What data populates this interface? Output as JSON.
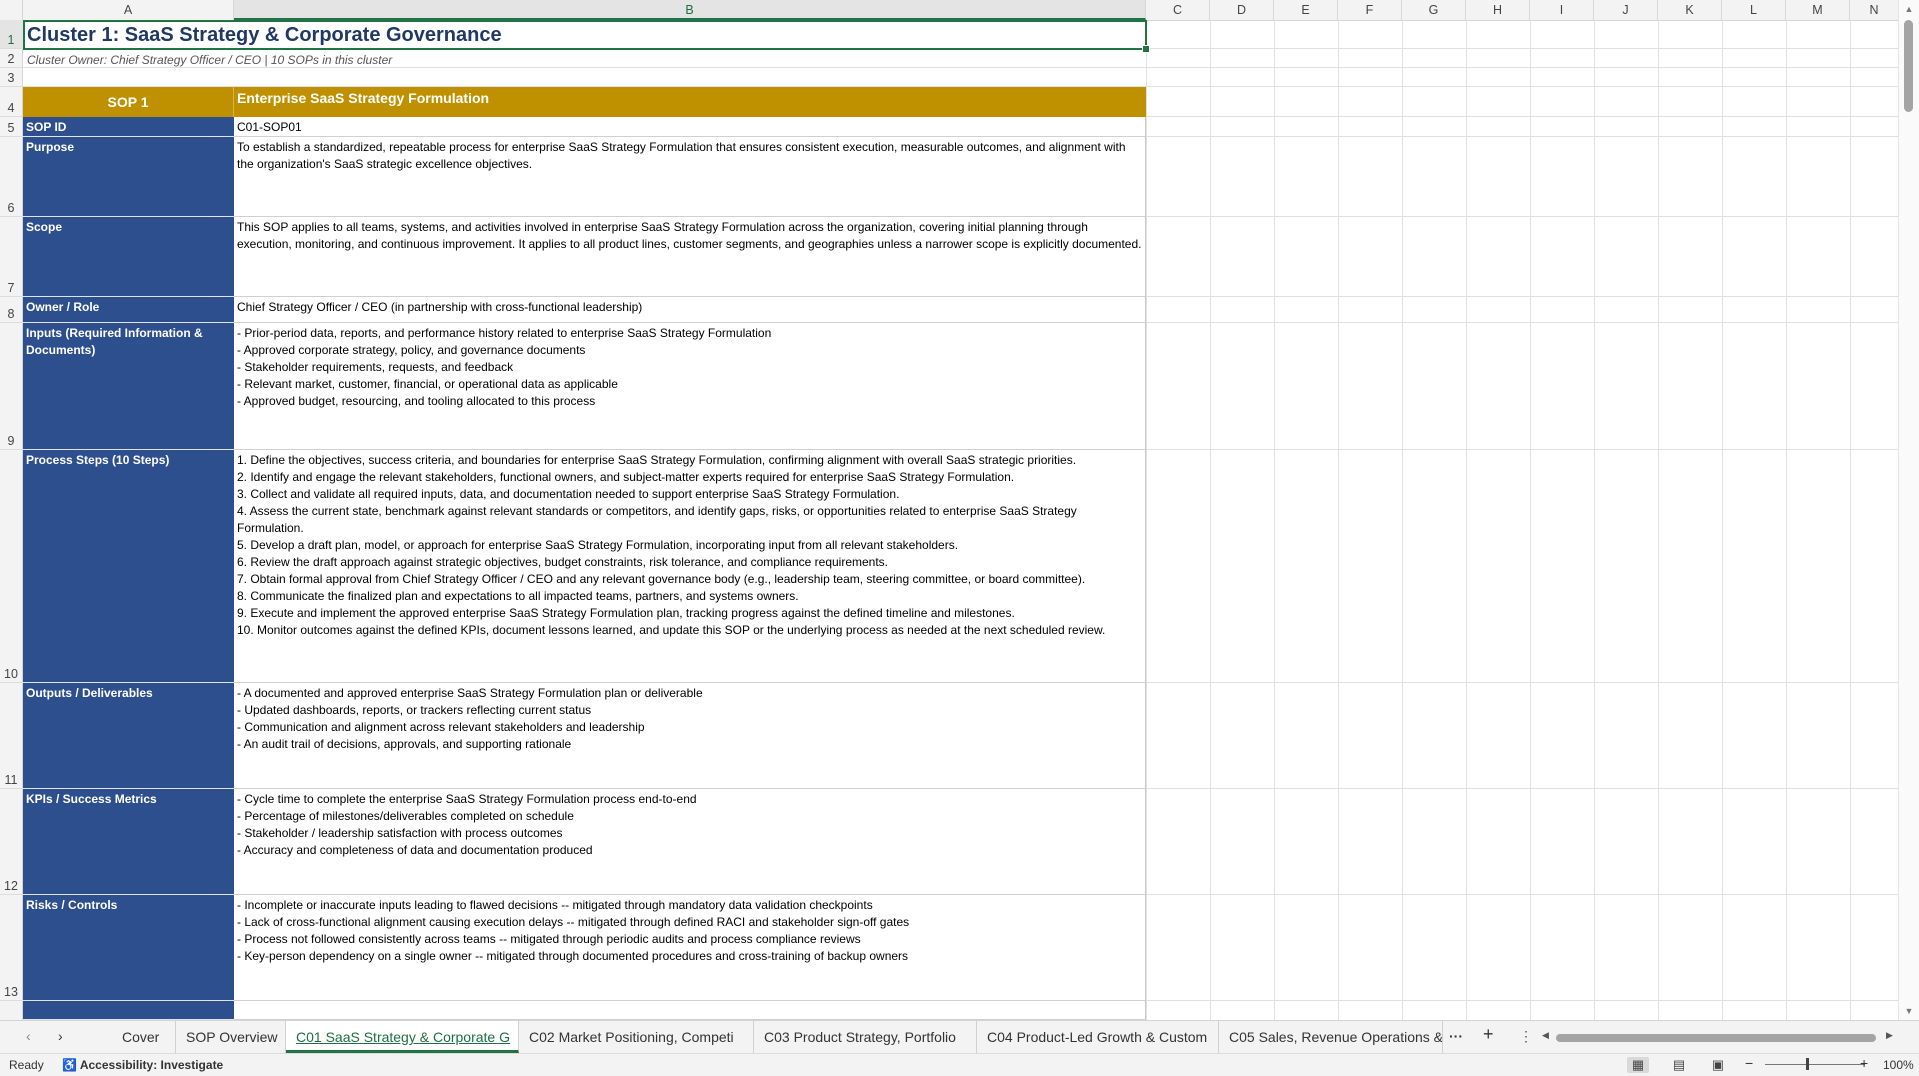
{
  "columns": [
    "A",
    "B",
    "C",
    "D",
    "E",
    "F",
    "G",
    "H",
    "I",
    "J",
    "K",
    "L",
    "M",
    "N"
  ],
  "selected_column": "B",
  "rows": [
    "1",
    "2",
    "3",
    "4",
    "5",
    "6",
    "7",
    "8",
    "9",
    "10",
    "11",
    "12",
    "13"
  ],
  "selected_row": "1",
  "sheet": {
    "title": "Cluster 1: SaaS Strategy & Corporate Governance",
    "subtitle": "Cluster Owner: Chief Strategy Officer / CEO  |  10 SOPs in this cluster",
    "sop_label": "SOP 1",
    "sop_name": "Enterprise SaaS Strategy Formulation",
    "header_color": "#bf9000",
    "label_color": "#2e4f8e",
    "rows": [
      {
        "label": "SOP ID",
        "value": "C01-SOP01"
      },
      {
        "label": "Purpose",
        "value": "To establish a standardized, repeatable process for enterprise SaaS Strategy Formulation that ensures consistent execution, measurable outcomes, and alignment with the organization's SaaS strategic excellence objectives."
      },
      {
        "label": "Scope",
        "value": "This SOP applies to all teams, systems, and activities involved in enterprise SaaS Strategy Formulation across the organization, covering initial planning through execution, monitoring, and continuous improvement. It applies to all product lines, customer segments, and geographies unless a narrower scope is explicitly documented."
      },
      {
        "label": "Owner / Role",
        "value": "Chief Strategy Officer / CEO (in partnership with cross-functional leadership)"
      },
      {
        "label": "Inputs (Required Information & Documents)",
        "value": "- Prior-period data, reports, and performance history related to enterprise SaaS Strategy Formulation\n- Approved corporate strategy, policy, and governance documents\n- Stakeholder requirements, requests, and feedback\n- Relevant market, customer, financial, or operational data as applicable\n- Approved budget, resourcing, and tooling allocated to this process"
      },
      {
        "label": "Process Steps (10 Steps)",
        "value": "1. Define the objectives, success criteria, and boundaries for enterprise SaaS Strategy Formulation, confirming alignment with overall SaaS strategic priorities.\n2. Identify and engage the relevant stakeholders, functional owners, and subject-matter experts required for enterprise SaaS Strategy Formulation.\n3. Collect and validate all required inputs, data, and documentation needed to support enterprise SaaS Strategy Formulation.\n4. Assess the current state, benchmark against relevant standards or competitors, and identify gaps, risks, or opportunities related to enterprise SaaS Strategy Formulation.\n5. Develop a draft plan, model, or approach for enterprise SaaS Strategy Formulation, incorporating input from all relevant stakeholders.\n6. Review the draft approach against strategic objectives, budget constraints, risk tolerance, and compliance requirements.\n7. Obtain formal approval from Chief Strategy Officer / CEO and any relevant governance body (e.g., leadership team, steering committee, or board committee).\n8. Communicate the finalized plan and expectations to all impacted teams, partners, and systems owners.\n9. Execute and implement the approved enterprise SaaS Strategy Formulation plan, tracking progress against the defined timeline and milestones.\n10. Monitor outcomes against the defined KPIs, document lessons learned, and update this SOP or the underlying process as needed at the next scheduled review."
      },
      {
        "label": "Outputs / Deliverables",
        "value": "- A documented and approved enterprise SaaS Strategy Formulation plan or deliverable\n- Updated dashboards, reports, or trackers reflecting current status\n- Communication and alignment across relevant stakeholders and leadership\n- An audit trail of decisions, approvals, and supporting rationale"
      },
      {
        "label": "KPIs / Success Metrics",
        "value": "- Cycle time to complete the enterprise SaaS Strategy Formulation process end-to-end\n- Percentage of milestones/deliverables completed on schedule\n- Stakeholder / leadership satisfaction with process outcomes\n- Accuracy and completeness of data and documentation produced"
      },
      {
        "label": "Risks / Controls",
        "value": "- Incomplete or inaccurate inputs leading to flawed decisions -- mitigated through mandatory data validation checkpoints\n- Lack of cross-functional alignment causing execution delays -- mitigated through defined RACI and stakeholder sign-off gates\n- Process not followed consistently across teams -- mitigated through periodic audits and process compliance reviews\n- Key-person dependency on a single owner -- mitigated through documented procedures and cross-training of backup owners"
      }
    ]
  },
  "tabs": [
    {
      "label": "Cover",
      "active": false
    },
    {
      "label": "SOP Overview",
      "active": false
    },
    {
      "label": "C01 SaaS Strategy & Corporate G",
      "active": true
    },
    {
      "label": "C02 Market Positioning, Competi",
      "active": false
    },
    {
      "label": "C03 Product Strategy, Portfolio",
      "active": false
    },
    {
      "label": "C04 Product-Led Growth & Custom",
      "active": false
    },
    {
      "label": "C05 Sales, Revenue Operations &",
      "active": false
    }
  ],
  "status": {
    "ready": "Ready",
    "accessibility": "Accessibility: Investigate",
    "zoom": "100%"
  },
  "icons": {
    "prev_sheet": "chevron-left-icon",
    "next_sheet": "chevron-right-icon",
    "more_sheets": "ellipsis-icon",
    "add_sheet": "plus-icon",
    "options": "vertical-dots-icon"
  }
}
